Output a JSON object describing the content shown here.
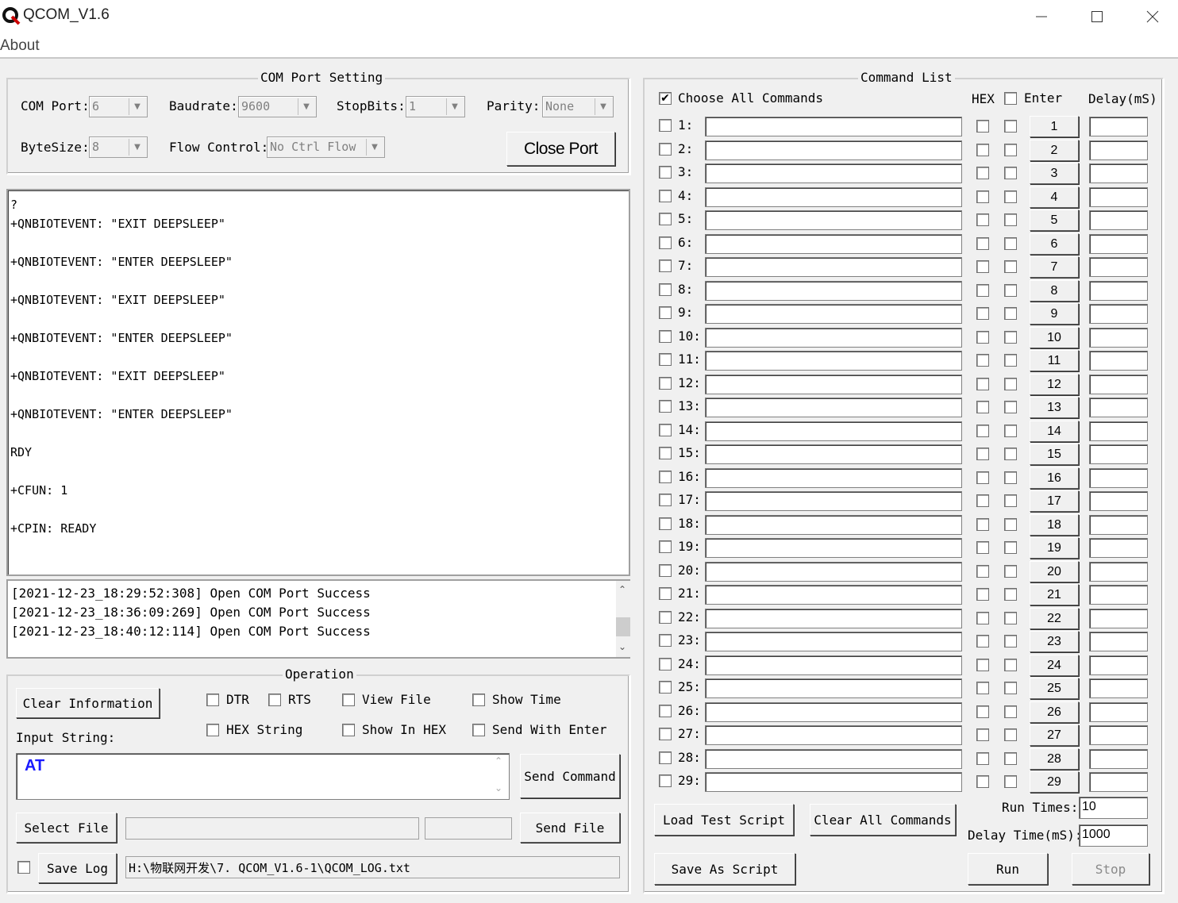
{
  "window": {
    "title": "QCOM_V1.6",
    "minimize_icon": "minimize-icon",
    "maximize_icon": "maximize-icon",
    "close_icon": "close-icon"
  },
  "menu": {
    "about": "About"
  },
  "com_port_setting": {
    "title": "COM Port Setting",
    "com_port_label": "COM Port:",
    "com_port_value": "6",
    "baudrate_label": "Baudrate:",
    "baudrate_value": "9600",
    "stopbits_label": "StopBits:",
    "stopbits_value": "1",
    "parity_label": "Parity:",
    "parity_value": "None",
    "bytesize_label": "ByteSize:",
    "bytesize_value": "8",
    "flow_control_label": "Flow Control:",
    "flow_control_value": "No Ctrl Flow",
    "close_port_label": "Close Port"
  },
  "receive_text": "?\n+QNBIOTEVENT: \"EXIT DEEPSLEEP\"\n\n+QNBIOTEVENT: \"ENTER DEEPSLEEP\"\n\n+QNBIOTEVENT: \"EXIT DEEPSLEEP\"\n\n+QNBIOTEVENT: \"ENTER DEEPSLEEP\"\n\n+QNBIOTEVENT: \"EXIT DEEPSLEEP\"\n\n+QNBIOTEVENT: \"ENTER DEEPSLEEP\"\n\nRDY\n\n+CFUN: 1\n\n+CPIN: READY",
  "log_lines": [
    "[2021-12-23_18:29:52:308] Open COM Port Success",
    "[2021-12-23_18:36:09:269] Open COM Port Success",
    "[2021-12-23_18:40:12:114] Open COM Port Success"
  ],
  "operation": {
    "title": "Operation",
    "clear_information": "Clear Information",
    "dtr": "DTR",
    "rts": "RTS",
    "view_file": "View File",
    "show_time": "Show Time",
    "hex_string": "HEX String",
    "show_in_hex": "Show In HEX",
    "send_with_enter": "Send With Enter",
    "input_string_label": "Input String:",
    "input_string_value": "AT",
    "send_command": "Send Command",
    "select_file": "Select File",
    "send_file": "Send File",
    "save_log": "Save Log",
    "log_path": "H:\\物联网开发\\7. QCOM_V1.6-1\\QCOM_LOG.txt"
  },
  "command_list": {
    "title": "Command List",
    "choose_all": "Choose All Commands",
    "choose_all_checked": true,
    "hex_header": "HEX",
    "enter_header": "Enter",
    "delay_header": "Delay(mS)",
    "rows": [
      "1",
      "2",
      "3",
      "4",
      "5",
      "6",
      "7",
      "8",
      "9",
      "10",
      "11",
      "12",
      "13",
      "14",
      "15",
      "16",
      "17",
      "18",
      "19",
      "20",
      "21",
      "22",
      "23",
      "24",
      "25",
      "26",
      "27",
      "28",
      "29"
    ],
    "load_test_script": "Load Test Script",
    "clear_all_commands": "Clear All Commands",
    "save_as_script": "Save As Script",
    "run_times_label": "Run Times:",
    "run_times_value": "10",
    "delay_time_label": "Delay Time(mS):",
    "delay_time_value": "1000",
    "run": "Run",
    "stop": "Stop"
  },
  "colors": {
    "input_text": "#1a1aff",
    "background": "#f0f0f0"
  }
}
